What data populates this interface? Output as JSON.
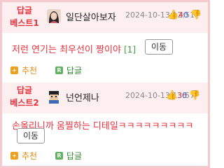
{
  "comments": [
    {
      "badge_line1": "답글",
      "badge_line2": "베스트1",
      "nickname": "일단살아보자",
      "timestamp": "2024-10-13 12:51",
      "likes": "4",
      "dislikes": "0",
      "text": "저런 연기는 최우선이 짱이야",
      "reply_count": "[1]",
      "move_label": "이동",
      "recommend_label": "추천",
      "reply_label": "답글",
      "avatar_icon": "woman-avatar-icon"
    },
    {
      "badge_line1": "답글",
      "badge_line2": "베스트2",
      "nickname": "넌언제나",
      "timestamp": "2024-10-13 13:57",
      "likes": "36",
      "dislikes": "0",
      "text": "손올리니까 움찔하는 디테일ㅋㅋㅋㅋㅋㅋㅋㅋㅋ",
      "move_label": "이동",
      "recommend_label": "추천",
      "reply_label": "답글",
      "avatar_icon": "pixel-avatar-icon"
    }
  ],
  "colors": {
    "accent_red": "#e8323c",
    "header_bg": "#fdeef0",
    "border": "#f5c9cd",
    "like": "#e23b3b",
    "dislike": "#3a6fd8"
  }
}
